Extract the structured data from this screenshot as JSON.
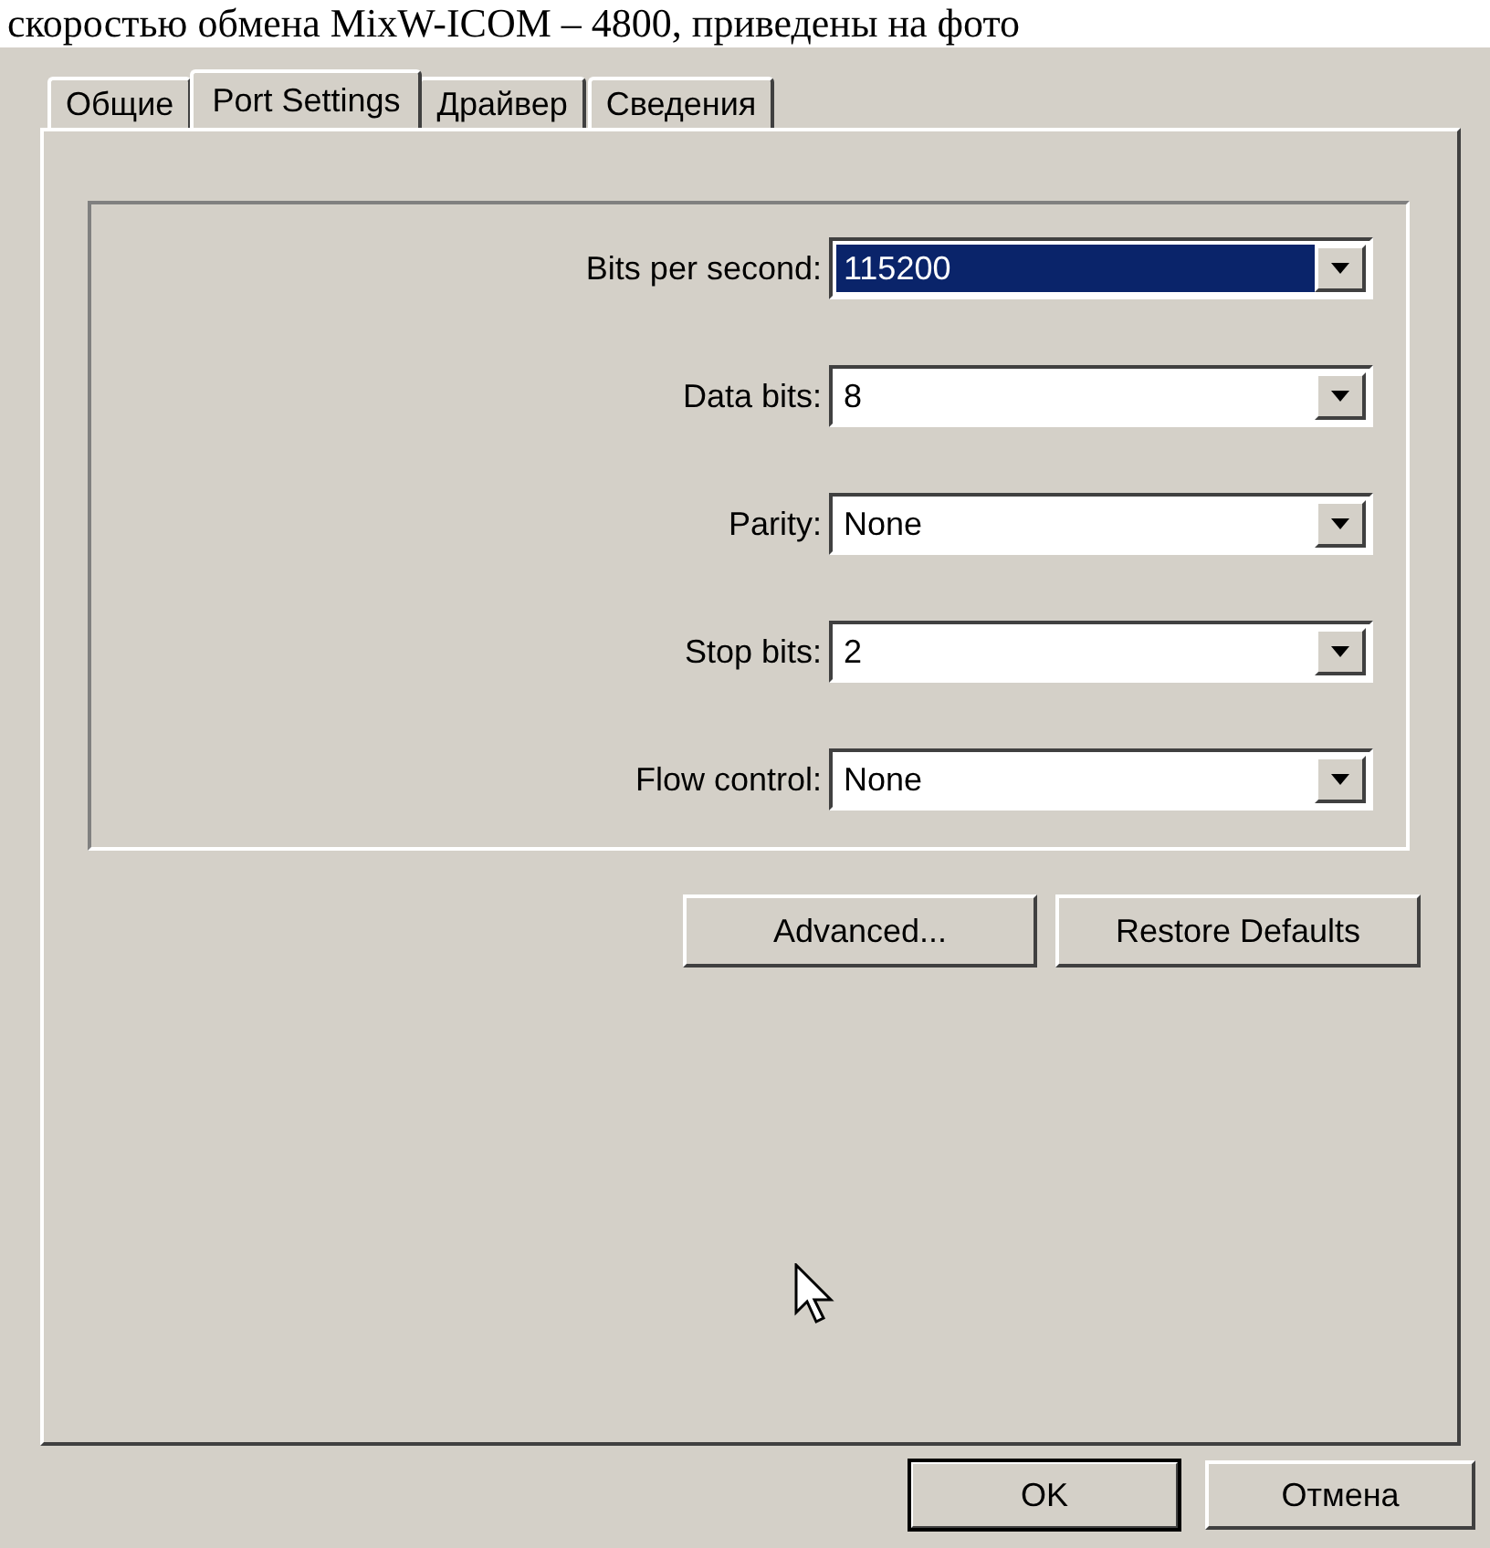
{
  "caption": "скоростью обмена MixW-ICOM – 4800, приведены на фото",
  "tabs": [
    {
      "label": "Общие",
      "selected": false
    },
    {
      "label": "Port Settings",
      "selected": true
    },
    {
      "label": "Драйвер",
      "selected": false
    },
    {
      "label": "Сведения",
      "selected": false
    }
  ],
  "fields": [
    {
      "label": "Bits per second:",
      "value": "115200",
      "selected": true
    },
    {
      "label": "Data bits:",
      "value": "8",
      "selected": false
    },
    {
      "label": "Parity:",
      "value": "None",
      "selected": false
    },
    {
      "label": "Stop bits:",
      "value": "2",
      "selected": false
    },
    {
      "label": "Flow control:",
      "value": "None",
      "selected": false
    }
  ],
  "panel_buttons": [
    "Advanced...",
    "Restore Defaults"
  ],
  "dialog_buttons": [
    {
      "label": "OK",
      "default": true
    },
    {
      "label": "Отмена",
      "default": false
    }
  ]
}
